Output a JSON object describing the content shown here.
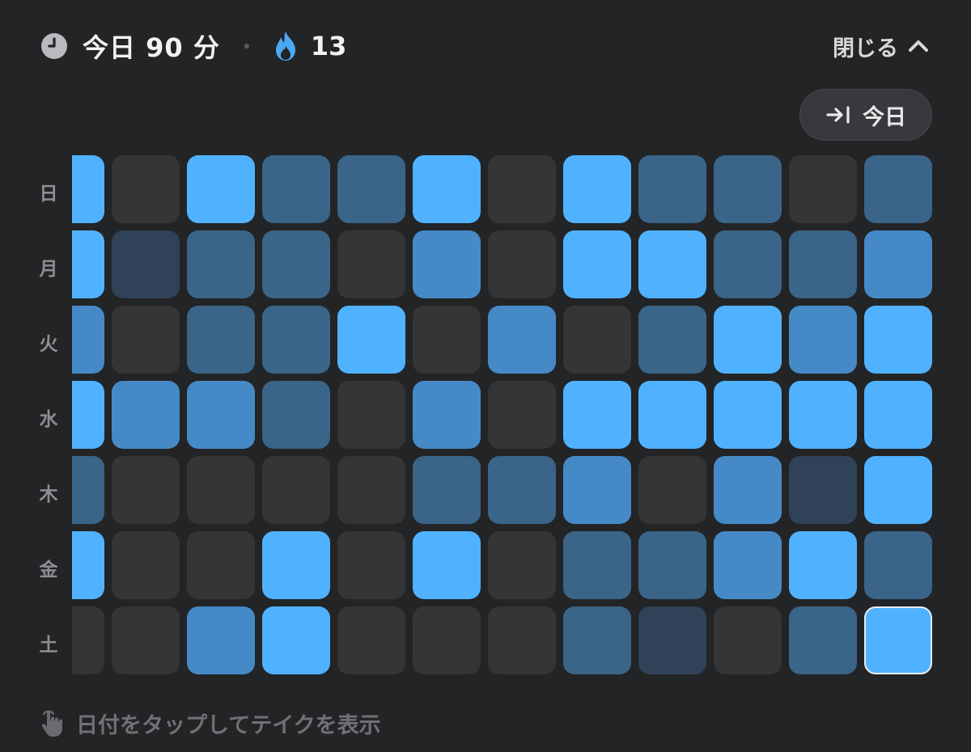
{
  "header": {
    "today_label": "今日 90 分",
    "streak_count": "13",
    "collapse_label": "閉じる",
    "icons": {
      "clock": "clock-icon",
      "streak": "flame-icon",
      "collapse": "chevron-up-icon"
    }
  },
  "today_button": {
    "label": "今日",
    "icon": "jump-to-today-icon"
  },
  "day_labels": [
    "日",
    "月",
    "火",
    "水",
    "木",
    "金",
    "土"
  ],
  "levels": {
    "colors": [
      "#343537",
      "#2f4257",
      "#3a6588",
      "#458ac6",
      "#50b2ff"
    ],
    "grid": [
      [
        4,
        0,
        4,
        2,
        2,
        4,
        0,
        4,
        2,
        2,
        0,
        2
      ],
      [
        4,
        1,
        2,
        2,
        0,
        3,
        0,
        4,
        4,
        2,
        2,
        3
      ],
      [
        3,
        0,
        2,
        2,
        4,
        0,
        3,
        0,
        2,
        4,
        3,
        4
      ],
      [
        4,
        3,
        3,
        2,
        0,
        3,
        0,
        4,
        4,
        4,
        4,
        4
      ],
      [
        2,
        0,
        0,
        0,
        0,
        2,
        2,
        3,
        0,
        3,
        1,
        4
      ],
      [
        4,
        0,
        0,
        4,
        0,
        4,
        0,
        2,
        2,
        3,
        4,
        2
      ],
      [
        0,
        0,
        3,
        4,
        0,
        0,
        0,
        2,
        1,
        0,
        2,
        4
      ]
    ],
    "selected_cell": [
      6,
      11
    ]
  },
  "hint": {
    "text": "日付をタップしてテイクを表示",
    "icon": "tap-hand-icon"
  }
}
